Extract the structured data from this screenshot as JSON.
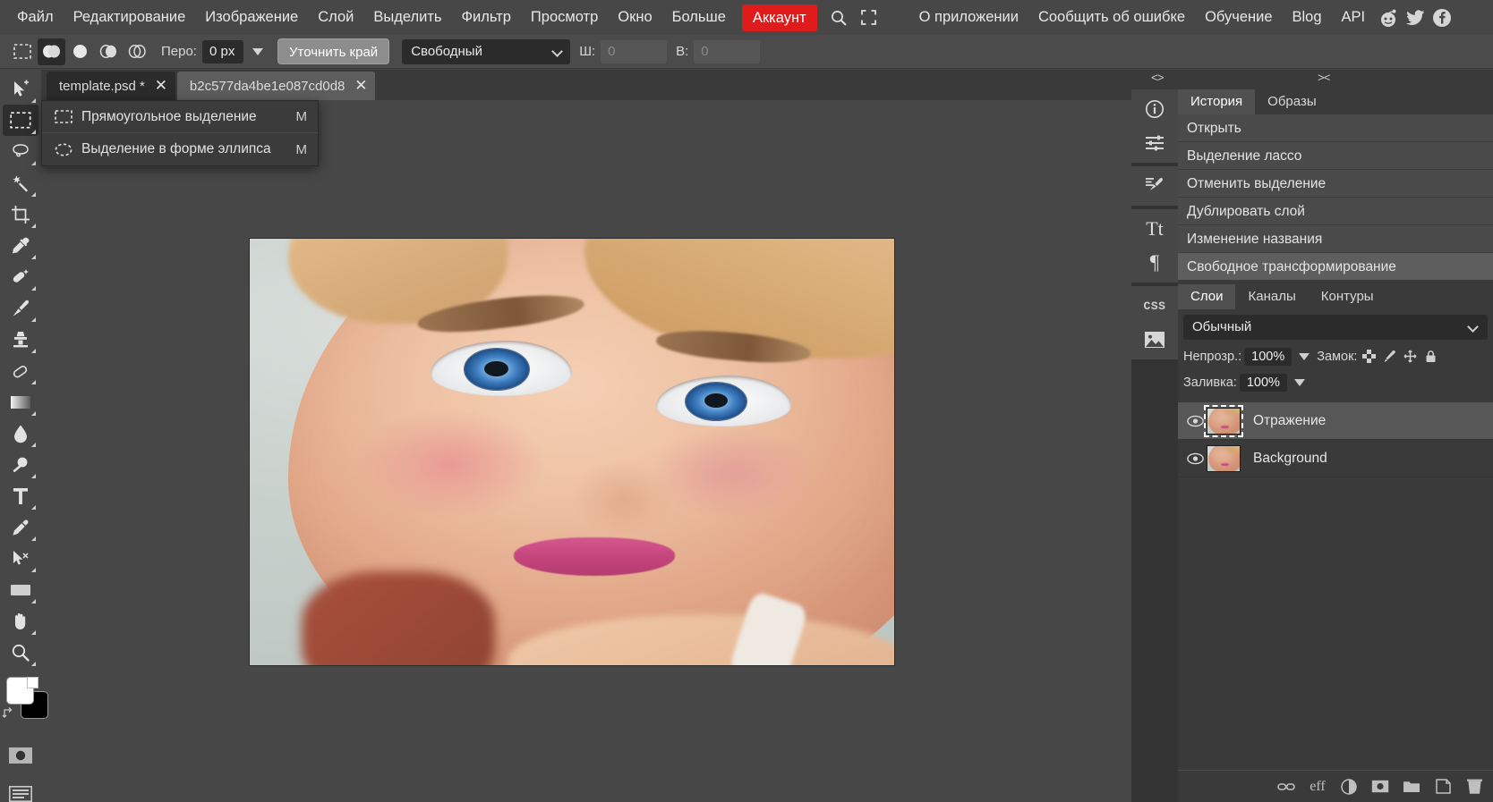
{
  "menu": {
    "items": [
      {
        "label": "Файл",
        "name": "menu-file"
      },
      {
        "label": "Редактирование",
        "name": "menu-edit"
      },
      {
        "label": "Изображение",
        "name": "menu-image"
      },
      {
        "label": "Слой",
        "name": "menu-layer"
      },
      {
        "label": "Выделить",
        "name": "menu-select"
      },
      {
        "label": "Фильтр",
        "name": "menu-filter"
      },
      {
        "label": "Просмотр",
        "name": "menu-view"
      },
      {
        "label": "Окно",
        "name": "menu-window"
      },
      {
        "label": "Больше",
        "name": "menu-more"
      }
    ],
    "account_label": "Аккаунт",
    "right_items": [
      {
        "label": "О приложении",
        "name": "menu-about"
      },
      {
        "label": "Сообщить об ошибке",
        "name": "menu-report-bug"
      },
      {
        "label": "Обучение",
        "name": "menu-learn"
      },
      {
        "label": "Blog",
        "name": "menu-blog"
      },
      {
        "label": "API",
        "name": "menu-api"
      }
    ],
    "icons": {
      "search": "search-icon",
      "fullscreen": "fullscreen-icon",
      "reddit": "reddit-icon",
      "twitter": "twitter-icon",
      "facebook": "facebook-icon"
    },
    "accent_red": "#e01b1b"
  },
  "options_bar": {
    "selection_modes": [
      "new-selection",
      "add-to-selection",
      "subtract-from-selection",
      "intersect-selection"
    ],
    "active_mode_index": 1,
    "feather_label": "Перо:",
    "feather_value": "0 px",
    "refine_edge_label": "Уточнить край",
    "style_value": "Свободный",
    "width_label": "Ш:",
    "width_value": "0",
    "height_label": "В:",
    "height_value": "0"
  },
  "tool_menu": {
    "items": [
      {
        "label": "Прямоугольное выделение",
        "shortcut": "M",
        "icon": "rectangular-marquee-icon"
      },
      {
        "label": "Выделение в форме эллипса",
        "shortcut": "M",
        "icon": "elliptical-marquee-icon"
      }
    ]
  },
  "tools": [
    {
      "name": "move-tool",
      "icon": "move-icon"
    },
    {
      "name": "marquee-tool",
      "icon": "rectangular-marquee-icon",
      "active": true
    },
    {
      "name": "lasso-tool",
      "icon": "lasso-icon"
    },
    {
      "name": "magic-wand-tool",
      "icon": "magic-wand-icon"
    },
    {
      "name": "crop-tool",
      "icon": "crop-icon"
    },
    {
      "name": "eyedropper-tool",
      "icon": "eyedropper-icon"
    },
    {
      "name": "healing-brush-tool",
      "icon": "healing-brush-icon"
    },
    {
      "name": "brush-tool",
      "icon": "brush-icon"
    },
    {
      "name": "clone-stamp-tool",
      "icon": "clone-stamp-icon"
    },
    {
      "name": "eraser-tool",
      "icon": "eraser-icon"
    },
    {
      "name": "gradient-tool",
      "icon": "gradient-icon"
    },
    {
      "name": "blur-tool",
      "icon": "blur-drop-icon"
    },
    {
      "name": "dodge-tool",
      "icon": "dodge-icon"
    },
    {
      "name": "type-tool",
      "icon": "type-icon"
    },
    {
      "name": "pen-tool",
      "icon": "pen-icon"
    },
    {
      "name": "path-select-tool",
      "icon": "path-select-icon"
    },
    {
      "name": "shape-tool",
      "icon": "rectangle-shape-icon"
    },
    {
      "name": "hand-tool",
      "icon": "hand-icon"
    },
    {
      "name": "zoom-tool",
      "icon": "magnifier-icon"
    }
  ],
  "swatches": {
    "foreground": "#ffffff",
    "background": "#000000",
    "swap_icon": "swap-colors-icon",
    "quick_mask_icon": "quick-mask-icon",
    "screen_mode_icon": "screen-mode-icon"
  },
  "tabs": [
    {
      "title": "template.psd *",
      "active": true,
      "name": "tab-template-psd"
    },
    {
      "title": "b2c577da4be1e087cd0d8",
      "active": false,
      "name": "tab-b2c577da"
    }
  ],
  "canvas": {
    "document_name": "template.psd",
    "image_alt": "Портрет девушки крупным планом"
  },
  "right_dock": {
    "collapse_left_glyph": "<>",
    "collapse_right_glyph": "><",
    "rail_icons": [
      {
        "name": "info-icon",
        "glyph": "info"
      },
      {
        "name": "adjustments-icon",
        "glyph": "sliders"
      },
      {
        "name": "brush-settings-icon",
        "glyph": "brush"
      },
      {
        "name": "character-icon",
        "glyph": "Tt"
      },
      {
        "name": "paragraph-icon",
        "glyph": "¶"
      },
      {
        "name": "css-icon",
        "glyph": "CSS"
      },
      {
        "name": "image-icon",
        "glyph": "picture"
      }
    ],
    "history_panel": {
      "tabs": [
        {
          "label": "История",
          "active": true,
          "name": "tab-history"
        },
        {
          "label": "Образы",
          "active": false,
          "name": "tab-snapshots"
        }
      ],
      "entries": [
        {
          "label": "Открыть",
          "selected": false
        },
        {
          "label": "Выделение лассо",
          "selected": false
        },
        {
          "label": "Отменить выделение",
          "selected": false
        },
        {
          "label": "Дублировать слой",
          "selected": false
        },
        {
          "label": "Изменение названия",
          "selected": false
        },
        {
          "label": "Свободное трансформирование",
          "selected": true
        }
      ]
    },
    "layers_panel": {
      "tabs": [
        {
          "label": "Слои",
          "active": true,
          "name": "tab-layers"
        },
        {
          "label": "Каналы",
          "active": false,
          "name": "tab-channels"
        },
        {
          "label": "Контуры",
          "active": false,
          "name": "tab-paths"
        }
      ],
      "blend_mode": "Обычный",
      "opacity_label": "Непрозр.:",
      "opacity_value": "100%",
      "lock_label": "Замок:",
      "lock_icons": [
        "lock-transparency-icon",
        "lock-pixels-icon",
        "lock-position-icon",
        "lock-all-icon"
      ],
      "fill_label": "Заливка:",
      "fill_value": "100%",
      "layers": [
        {
          "name": "Отражение",
          "visible": true,
          "selected": true
        },
        {
          "name": "Background",
          "visible": true,
          "selected": false
        }
      ],
      "bottom_icons": [
        {
          "name": "link-layers-icon",
          "glyph": "link"
        },
        {
          "name": "layer-effects-icon",
          "glyph": "eff"
        },
        {
          "name": "adjustment-layer-icon",
          "glyph": "half-circle"
        },
        {
          "name": "layer-mask-icon",
          "glyph": "mask"
        },
        {
          "name": "new-group-icon",
          "glyph": "folder"
        },
        {
          "name": "new-layer-icon",
          "glyph": "page"
        },
        {
          "name": "delete-layer-icon",
          "glyph": "trash"
        }
      ]
    }
  }
}
